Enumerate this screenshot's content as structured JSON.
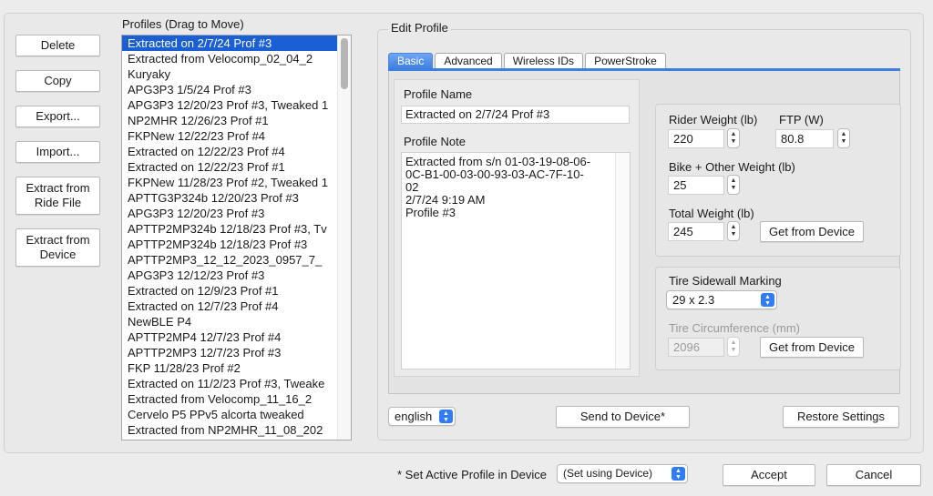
{
  "left_buttons": {
    "delete": "Delete",
    "copy": "Copy",
    "export": "Export...",
    "import": "Import...",
    "extract_ride_1": "Extract from",
    "extract_ride_2": "Ride File",
    "extract_device_1": "Extract from",
    "extract_device_2": "Device"
  },
  "profiles": {
    "title": "Profiles (Drag to Move)",
    "items": [
      "Extracted on 2/7/24 Prof #3",
      "Extracted from Velocomp_02_04_2",
      "Kuryaky",
      "APG3P3 1/5/24 Prof #3",
      "APG3P3 12/20/23 Prof #3, Tweaked 1",
      "NP2MHR 12/26/23 Prof #1",
      "FKPNew 12/22/23 Prof #4",
      "Extracted on 12/22/23 Prof #4",
      "Extracted on 12/22/23 Prof #1",
      "FKPNew 11/28/23 Prof #2, Tweaked 1",
      "APTTG3P324b 12/20/23 Prof #3",
      "APG3P3 12/20/23 Prof #3",
      "APTTP2MP324b 12/18/23 Prof #3, Tv",
      "APTTP2MP324b 12/18/23 Prof #3",
      " APTTP2MP3_12_12_2023_0957_7_",
      "APG3P3 12/12/23 Prof #3",
      "Extracted on 12/9/23 Prof #1",
      "Extracted on 12/7/23 Prof #4",
      "NewBLE P4",
      "APTTP2MP4 12/7/23 Prof #4",
      "APTTP2MP3 12/7/23 Prof #3",
      "FKP 11/28/23 Prof #2",
      "Extracted on 11/2/23 Prof #3, Tweake",
      "Extracted from Velocomp_11_16_2",
      "Cervelo P5 PPv5 alcorta tweaked",
      "Extracted from NP2MHR_11_08_202"
    ]
  },
  "edit_profile": {
    "title": "Edit Profile",
    "tabs": [
      "Basic",
      "Advanced",
      "Wireless IDs",
      "PowerStroke"
    ],
    "profile_name_label": "Profile Name",
    "profile_name_value": "Extracted on 2/7/24 Prof #3",
    "profile_note_label": "Profile Note",
    "profile_note_lines": [
      "Extracted from s/n 01-03-19-08-06-",
      "0C-B1-00-03-00-93-03-AC-7F-10-",
      "02",
      "2/7/24 9:19 AM",
      "Profile #3"
    ],
    "rider_weight_label": "Rider Weight (lb)",
    "rider_weight_value": "220",
    "ftp_label": "FTP (W)",
    "ftp_value": "80.8",
    "bike_weight_label": "Bike + Other Weight (lb)",
    "bike_weight_value": "25",
    "total_weight_label": "Total Weight (lb)",
    "total_weight_value": "245",
    "get_from_device": "Get from Device",
    "tire_marking_label": "Tire Sidewall Marking",
    "tire_marking_value": "29 x 2.3",
    "tire_circ_label": "Tire Circumference (mm)",
    "tire_circ_value": "2096",
    "language_value": "english",
    "send_to_device": "Send to Device*",
    "restore_settings": "Restore Settings"
  },
  "footer": {
    "active_profile_label": "* Set Active Profile in Device",
    "active_profile_value": "(Set using Device)",
    "accept": "Accept",
    "cancel": "Cancel"
  },
  "colors": {
    "selection": "#1a5fd3",
    "accent": "#2f7cf6"
  }
}
